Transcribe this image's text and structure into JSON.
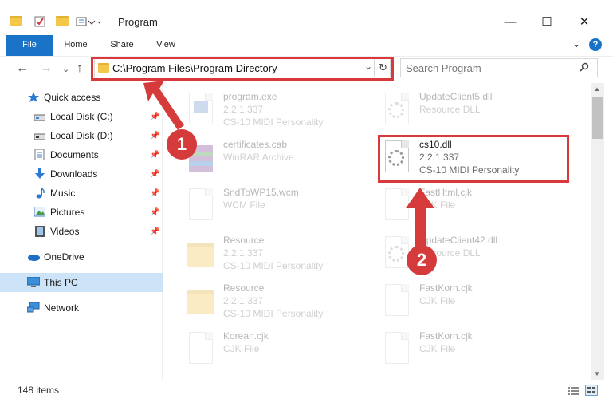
{
  "window": {
    "title": "Program",
    "minimize": "—",
    "maximize": "☐",
    "close": "✕"
  },
  "ribbon": {
    "tabs": [
      "File",
      "Home",
      "Share",
      "View"
    ],
    "expand": "⌄",
    "help": "?"
  },
  "address": {
    "path": "C:\\Program Files\\Program Directory",
    "refresh": "↻",
    "dropdown": "⌄"
  },
  "search": {
    "placeholder": "Search Program"
  },
  "nav": {
    "back": "←",
    "forward": "→",
    "recent": "⌄",
    "up": "↑"
  },
  "sidebar": {
    "items": [
      {
        "label": "Quick access",
        "icon": "star-icon"
      },
      {
        "label": "Local Disk (C:)",
        "icon": "drive-icon",
        "pinned": true
      },
      {
        "label": "Local Disk (D:)",
        "icon": "drive-icon",
        "pinned": true
      },
      {
        "label": "Documents",
        "icon": "documents-icon",
        "pinned": true
      },
      {
        "label": "Downloads",
        "icon": "download-icon",
        "pinned": true
      },
      {
        "label": "Music",
        "icon": "music-icon",
        "pinned": true
      },
      {
        "label": "Pictures",
        "icon": "pictures-icon",
        "pinned": true
      },
      {
        "label": "Videos",
        "icon": "videos-icon",
        "pinned": true
      },
      {
        "label": "OneDrive",
        "icon": "cloud-icon"
      },
      {
        "label": "This PC",
        "icon": "computer-icon",
        "selected": true
      },
      {
        "label": "Network",
        "icon": "network-icon"
      }
    ]
  },
  "files": [
    {
      "name": "program.exe",
      "line2": "2.2.1.337",
      "line3": "CS-10 MIDI Personality"
    },
    {
      "name": "UpdateClient5.dll",
      "line2": "Resource DLL",
      "line3": ""
    },
    {
      "name": "certificates.cab",
      "line2": "WinRAR Archive",
      "line3": ""
    },
    {
      "name": "cs10.dll",
      "line2": "2.2.1.337",
      "line3": "CS-10 MIDI Personality"
    },
    {
      "name": "SndToWP15.wcm",
      "line2": "WCM File",
      "line3": ""
    },
    {
      "name": "FastHtml.cjk",
      "line2": "CJK File",
      "line3": ""
    },
    {
      "name": "Resource",
      "line2": "2.2.1.337",
      "line3": "CS-10 MIDI Personality"
    },
    {
      "name": "UpdateClient42.dll",
      "line2": "Resource DLL",
      "line3": ""
    },
    {
      "name": "Resource",
      "line2": "2.2.1.337",
      "line3": "CS-10 MIDI Personality"
    },
    {
      "name": "FastKorn.cjk",
      "line2": "CJK File",
      "line3": ""
    },
    {
      "name": "Korean.cjk",
      "line2": "CJK File",
      "line3": ""
    },
    {
      "name": "FastKorn.cjk",
      "line2": "CJK File",
      "line3": ""
    }
  ],
  "status": {
    "items": "148 items"
  },
  "annotations": {
    "step1": "1",
    "step2": "2",
    "color": "#d63b3c"
  },
  "colors": {
    "accent": "#1a73c7",
    "selection": "#cde3f7"
  }
}
